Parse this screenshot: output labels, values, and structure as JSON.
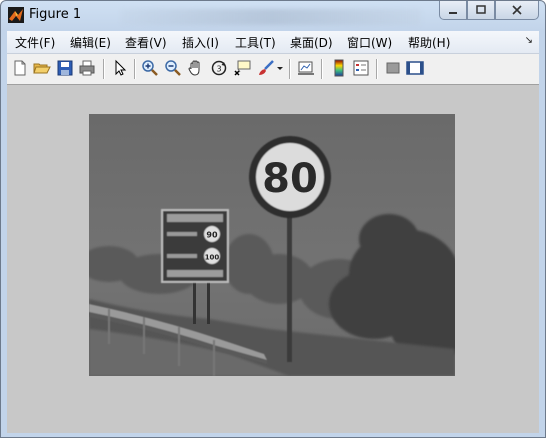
{
  "window": {
    "title": "Figure 1",
    "buttons": [
      "minimize",
      "maximize",
      "close"
    ]
  },
  "menu": {
    "items": [
      "文件(F)",
      "编辑(E)",
      "查看(V)",
      "插入(I)",
      "工具(T)",
      "桌面(D)",
      "窗口(W)",
      "帮助(H)"
    ]
  },
  "toolbar": {
    "icons": [
      "new-figure-icon",
      "open-icon",
      "save-icon",
      "print-icon",
      "pointer-icon",
      "zoom-in-icon",
      "zoom-out-icon",
      "pan-hand-icon",
      "rotate-3d-icon",
      "data-cursor-icon",
      "brush-icon",
      "brush-dropdown-icon",
      "link-plot-icon",
      "colorbar-icon",
      "legend-icon",
      "hide-plot-tools-icon",
      "show-plot-tools-icon"
    ]
  },
  "image": {
    "sign_speed": "80",
    "small_sign_values": [
      "90",
      "100"
    ],
    "description_colors": {
      "canvas": "#c8c8c8",
      "titlebar": "#c2d4ea"
    }
  }
}
